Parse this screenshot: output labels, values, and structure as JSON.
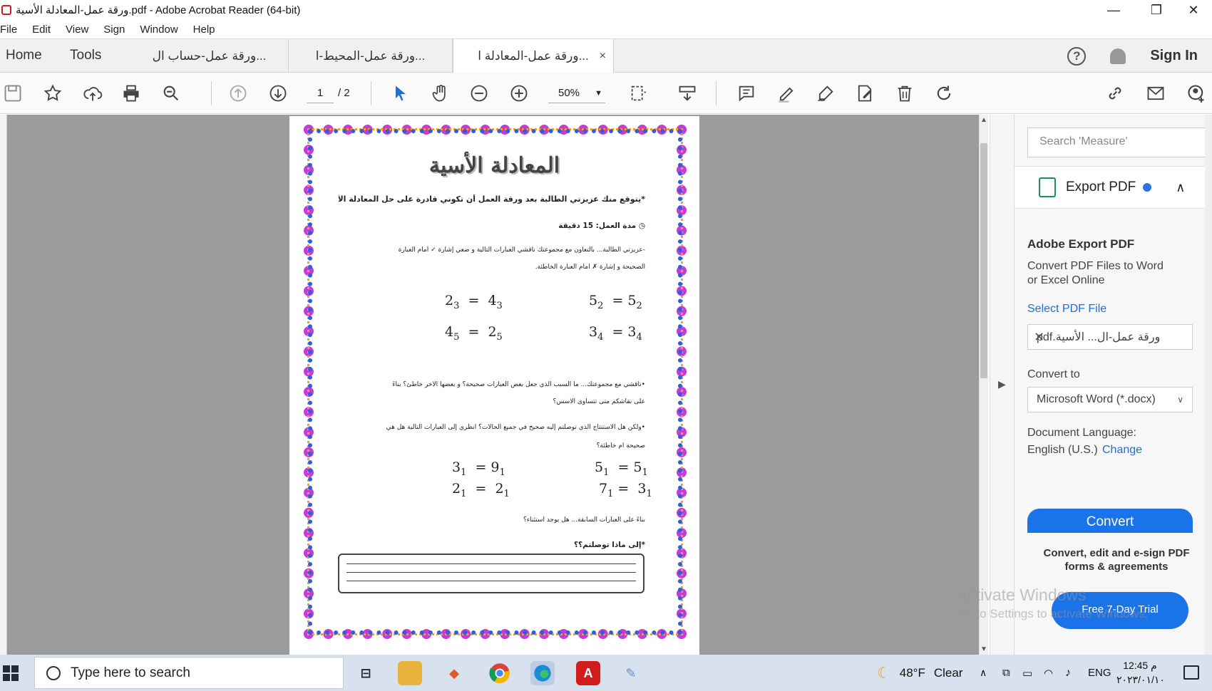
{
  "window": {
    "title": "ورقة عمل-المعادلة الأسية.pdf - Adobe Acrobat Reader (64-bit)",
    "minimize": "—",
    "restore": "❐",
    "close": "✕"
  },
  "menu": [
    "File",
    "Edit",
    "View",
    "Sign",
    "Window",
    "Help"
  ],
  "nav": {
    "home": "Home",
    "tools": "Tools"
  },
  "tabs": [
    {
      "label": "ورقة عمل-حساب ال...",
      "active": false
    },
    {
      "label": "ورقة عمل-المحيط-ا...",
      "active": false
    },
    {
      "label": "ورقة عمل-المعادلة ا...",
      "active": true,
      "close": "×"
    }
  ],
  "header": {
    "help": "?",
    "signin": "Sign In"
  },
  "toolbar": {
    "page_current": "1",
    "page_total": "/ 2",
    "zoom": "50%",
    "zoom_arrow": "▼",
    "icons": [
      "save-icon",
      "bookmark-star-icon",
      "upload-cloud-icon",
      "print-icon",
      "zoom-search-icon",
      "page-up-icon",
      "page-down-icon",
      "select-cursor-icon",
      "hand-pan-icon",
      "zoom-out-icon",
      "zoom-in-icon",
      "fit-page-icon",
      "read-mode-icon",
      "comment-icon",
      "highlight-pen-icon",
      "fill-sign-icon",
      "edit-pdf-icon",
      "delete-icon",
      "rotate-icon",
      "link-icon",
      "email-icon",
      "share-user-icon"
    ]
  },
  "document": {
    "title": "المعادلة الأسية",
    "objective": "*يتوقع منك عزيزتي الطالبة بعد ورقة العمل أن تكوني قادرة على حل المعادلة الأسية.",
    "duration": "◷ مدة العمل: 15 دقيقة",
    "instr_1": "-عزيزتي الطالبة... بالتعاون مع مجموعتك ناقشي العبارات التالية و ضعي إشارة ✓ أمام العبارة",
    "instr_2": "الصحيحة و إشارة ✗ أمام العبارة الخاطئة.",
    "set1": [
      {
        "lhs_base": "2",
        "lhs_sub": "3",
        "rhs_base": "4",
        "rhs_sub": "3"
      },
      {
        "lhs_base": "5",
        "lhs_sub": "2",
        "rhs_base": "5",
        "rhs_sub": "2"
      },
      {
        "lhs_base": "4",
        "lhs_sub": "5",
        "rhs_base": "2",
        "rhs_sub": "5"
      },
      {
        "lhs_base": "3",
        "lhs_sub": "4",
        "rhs_base": "3",
        "rhs_sub": "4"
      }
    ],
    "discuss_1": "•ناقشي مع مجموعتك... ما السبب الذي جعل بعض العبارات صحيحة؟ و بعضها الآخر خاطئ؟ بناءً",
    "discuss_2": "على نقاشكم متى تتساوى الأسس؟",
    "conclude_1": "•ولكن هل الاستنتاج الذي توصلتم إليه صحيح في جميع الحالات؟ انظري إلى العبارات التالية هل هي",
    "conclude_2": "صحيحة أم خاطئة؟",
    "set2": [
      {
        "lhs_base": "3",
        "lhs_sub": "1",
        "rhs_base": "9",
        "rhs_sub": "1"
      },
      {
        "lhs_base": "5",
        "lhs_sub": "1",
        "rhs_base": "5",
        "rhs_sub": "1"
      },
      {
        "lhs_base": "2",
        "lhs_sub": "1",
        "rhs_base": "2",
        "rhs_sub": "1"
      },
      {
        "lhs_base": "7",
        "lhs_sub": "1",
        "rhs_base": "3",
        "rhs_sub": "1"
      }
    ],
    "exception": "بناءً على العبارات السابقة... هل يوجد استثناء؟",
    "reached": "*إلى ماذا توصلتم؟؟",
    "frame_colors": [
      "#c43bd6",
      "#f39c2a",
      "#2f5fd8"
    ]
  },
  "right_panel": {
    "search_placeholder": "Search 'Measure'",
    "export_label": "Export PDF",
    "export_title": "Adobe Export PDF",
    "export_desc_1": "Convert PDF Files to Word",
    "export_desc_2": "or Excel Online",
    "select_file": "Select PDF File",
    "selected_file": "ورقة عمل-ال... الأسية.pdf",
    "convert_to_label": "Convert to",
    "convert_to_value": "Microsoft Word (*.docx)",
    "doc_lang_label": "Document Language:",
    "doc_lang_value": "English (U.S.)",
    "change": "Change",
    "convert_btn": "Convert",
    "promo_1": "Convert, edit and e-sign PDF",
    "promo_2": "forms & agreements",
    "trial_btn": "Free 7-Day Trial",
    "accent": "#1a73e8"
  },
  "watermark": {
    "line1": "Activate Windows",
    "line2": "Go to Settings to activate Windows."
  },
  "taskbar": {
    "search_text": "Type here to search",
    "weather_temp": "48°F",
    "weather_cond": "Clear",
    "lang": "ENG",
    "time": "12:45 م",
    "date": "٢٠٢٣/٠١/١٠"
  }
}
